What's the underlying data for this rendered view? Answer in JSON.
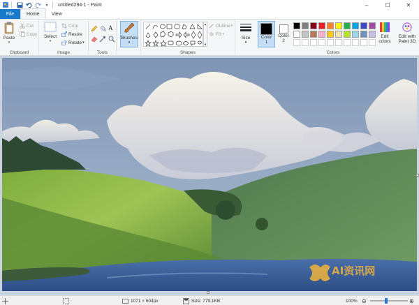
{
  "window": {
    "title": "untitled294-1 - Paint",
    "controls": {
      "minimize": "–",
      "maximize": "☐",
      "close": "✕"
    }
  },
  "tabs": {
    "file": "File",
    "home": "Home",
    "view": "View"
  },
  "ribbon": {
    "clipboard": {
      "label": "Clipboard",
      "paste": "Paste",
      "cut": "Cut",
      "copy": "Copy"
    },
    "image": {
      "label": "Image",
      "select": "Select",
      "crop": "Crop",
      "resize": "Resize",
      "rotate": "Rotate"
    },
    "tools": {
      "label": "Tools",
      "brushes": "Brushes"
    },
    "shapes": {
      "label": "Shapes",
      "outline": "Outline",
      "fill": "Fill"
    },
    "size": {
      "label": "Size"
    },
    "color1": {
      "label": "Color",
      "index": "1"
    },
    "color2": {
      "label": "Color",
      "index": "2"
    },
    "colors": {
      "label": "Colors",
      "edit_label": "Edit",
      "edit_label2": "colors",
      "paint3d_label": "Edit with",
      "paint3d_label2": "Paint 3D",
      "row1": [
        "#000000",
        "#7f7f7f",
        "#880015",
        "#ed1c24",
        "#ff7f27",
        "#fff200",
        "#22b14c",
        "#00a2e8",
        "#3f48cc",
        "#a349a4"
      ],
      "row2": [
        "#ffffff",
        "#c3c3c3",
        "#b97a57",
        "#ffaec9",
        "#ffc90e",
        "#efe4b0",
        "#b5e61d",
        "#99d9ea",
        "#7092be",
        "#c8bfe7"
      ],
      "primary": "#000000",
      "secondary": "#ffffff"
    }
  },
  "status": {
    "dimensions": "1071 × 604px",
    "size": "Size: 779.1KB",
    "zoom": "100%"
  },
  "watermark": {
    "text": "AI资讯网"
  }
}
